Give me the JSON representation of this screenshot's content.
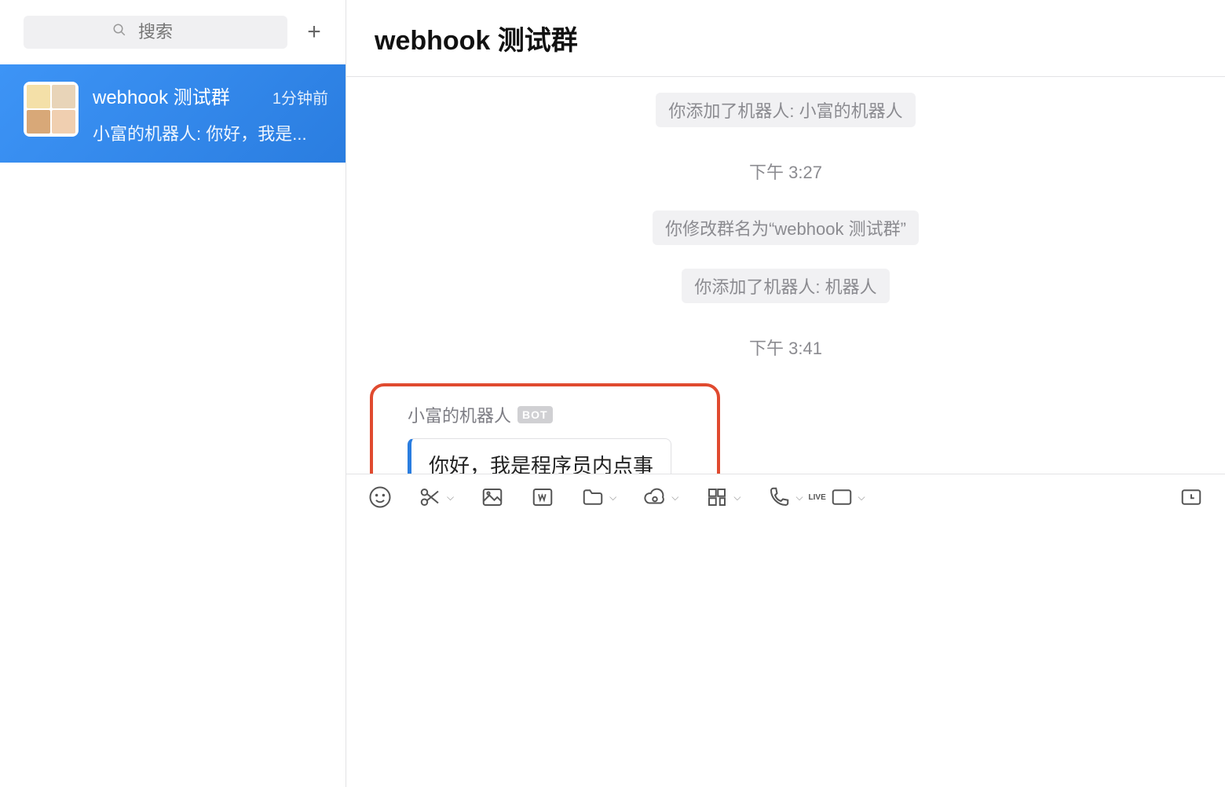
{
  "sidebar": {
    "search_placeholder": "搜索",
    "add_label": "+",
    "conversation": {
      "title": "webhook 测试群",
      "time": "1分钟前",
      "preview": "小富的机器人: 你好，我是..."
    }
  },
  "chat": {
    "title": "webhook 测试群",
    "messages": [
      {
        "type": "system",
        "text": "你添加了机器人: 小富的机器人"
      },
      {
        "type": "time",
        "text": "下午 3:27"
      },
      {
        "type": "system",
        "text": "你修改群名为“webhook 测试群”"
      },
      {
        "type": "system",
        "text": "你添加了机器人: 机器人"
      },
      {
        "type": "time",
        "text": "下午 3:41"
      }
    ],
    "bot_message": {
      "sender": "小富的机器人",
      "badge": "BOT",
      "text": "你好，我是程序员内点事"
    }
  },
  "toolbar": {
    "icons": {
      "emoji": "emoji-icon",
      "scissors": "scissors-icon",
      "image": "image-icon",
      "word": "word-icon",
      "folder": "folder-icon",
      "cloud": "cloud-icon",
      "grid": "apps-icon",
      "phone": "phone-icon",
      "live": "live-icon",
      "history": "history-icon"
    },
    "live_label": "LIVE"
  }
}
